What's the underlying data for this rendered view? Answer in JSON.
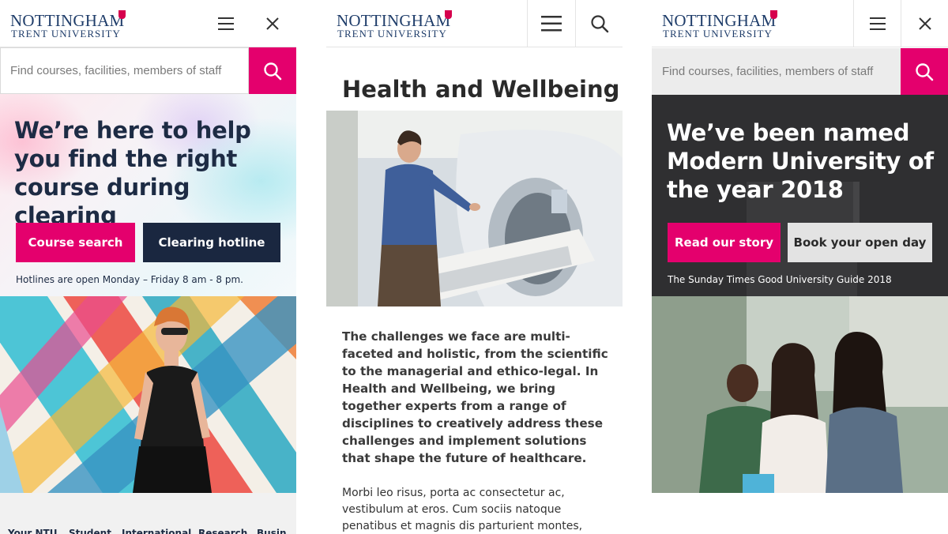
{
  "logo": {
    "line1": "NOTTINGHAM",
    "line2": "TRENT UNIVERSITY"
  },
  "colors": {
    "brand_navy": "#1f3d6a",
    "accent_pink": "#e4006d",
    "dark_navy": "#1a2740",
    "dark_grey": "#2f2f31"
  },
  "icons": {
    "menu": "hamburger-icon",
    "close": "close-icon",
    "search": "search-icon"
  },
  "panel1": {
    "search_placeholder": "Find courses, facilities, members of staff",
    "hero_title": "We’re here to help you find the right course during clearing",
    "primary_button": "Course search",
    "secondary_button": "Clearing hotline",
    "note": "Hotlines are open Monday – Friday 8 am - 8 pm.",
    "nav": [
      "Your NTU",
      "Student",
      "International",
      "Research",
      "Busin"
    ]
  },
  "panel2": {
    "title": "Health and Wellbeing",
    "lead": "The challenges we face are multi-faceted and holistic, from the scientific to the managerial and ethico-legal. In Health and Wellbeing, we bring together experts from a range of disciplines to creatively address these challenges and implement solutions that shape the future of healthcare.",
    "body": "Morbi leo risus, porta ac consectetur ac, vestibulum at eros. Cum sociis natoque penatibus et magnis dis parturient montes,"
  },
  "panel3": {
    "search_placeholder": "Find courses, facilities, members of staff",
    "hero_title": "We’ve been named Modern University of the year 2018",
    "primary_button": "Read our story",
    "secondary_button": "Book your open day",
    "note": "The Sunday Times Good University Guide 2018"
  }
}
